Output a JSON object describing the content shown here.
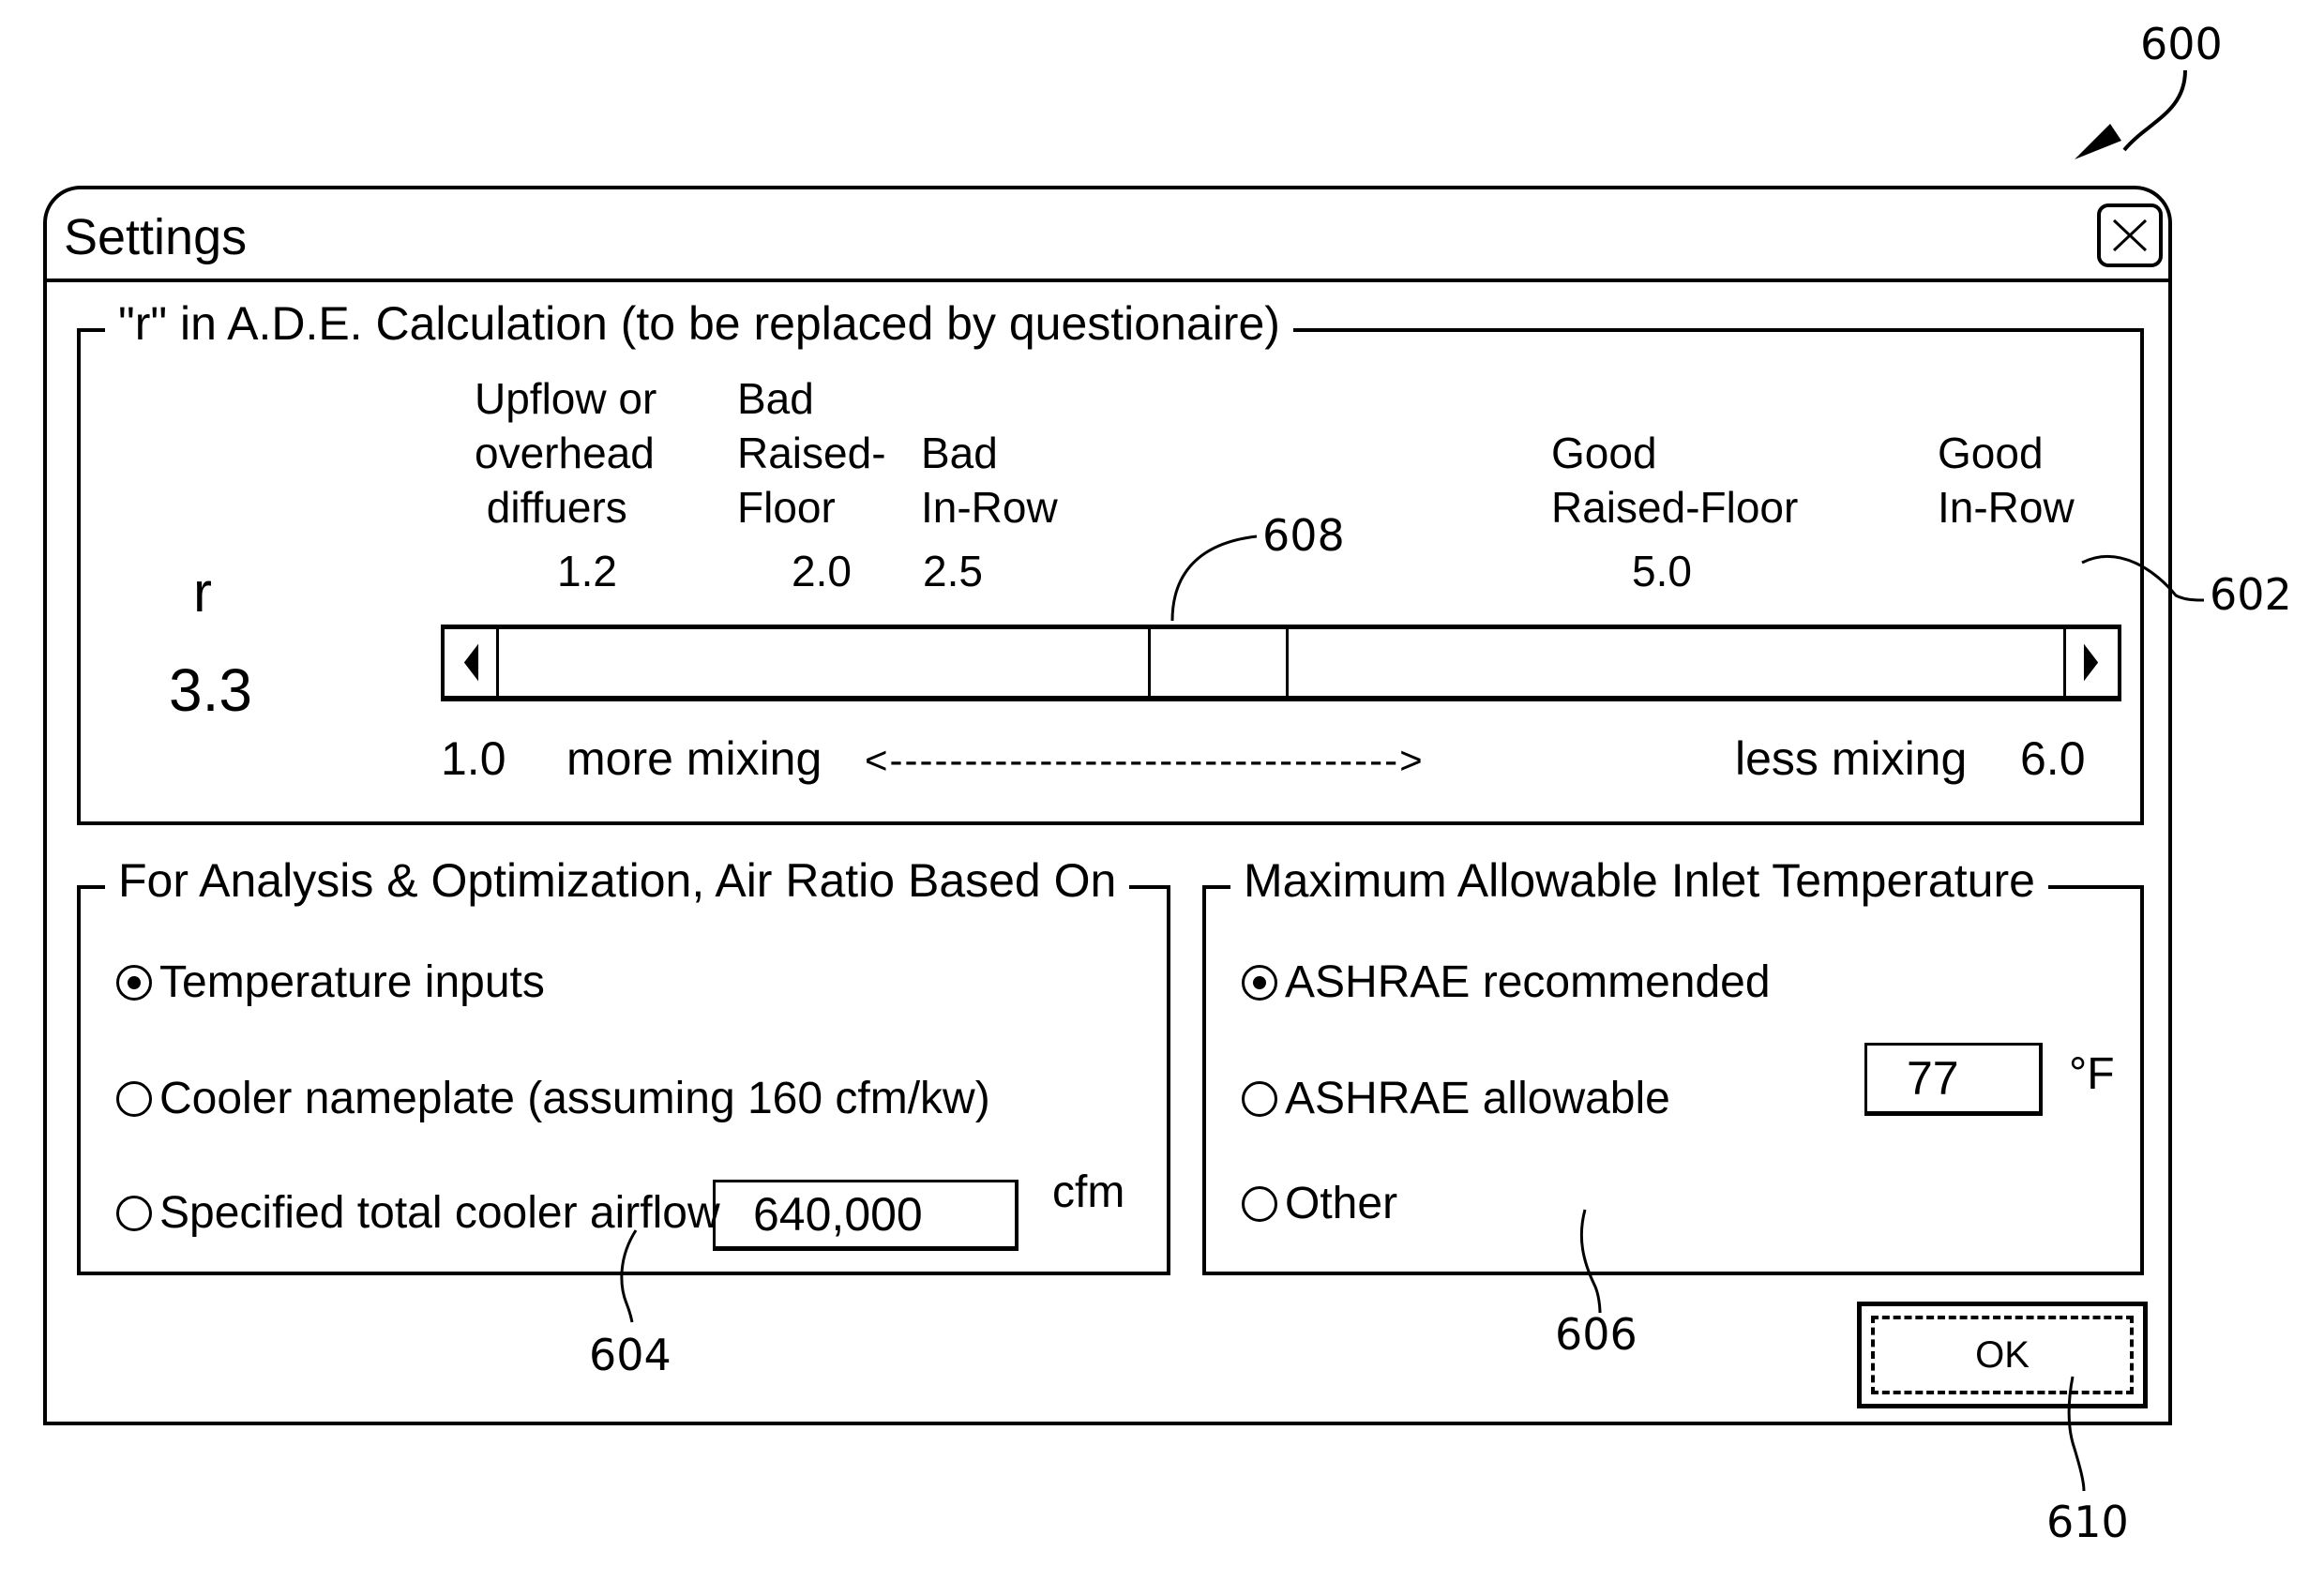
{
  "window": {
    "title": "Settings",
    "close_icon": "close-x-icon"
  },
  "r_group": {
    "legend": "\"r\" in A.D.E. Calculation (to be replaced by questionaire)",
    "r_label": "r",
    "r_value": "3.3",
    "slider": {
      "min": 1.0,
      "max": 6.0,
      "value": 3.3,
      "min_label": "1.0",
      "max_label": "6.0",
      "left_text": "more mixing",
      "right_text": "less mixing",
      "direction_arrow": "<---------------------------------->",
      "left_arrow_icon": "triangle-left-icon",
      "right_arrow_icon": "triangle-right-icon"
    },
    "presets": [
      {
        "label": "Upflow or\noverhead\n diffuers",
        "value": "1.2"
      },
      {
        "label": "Bad\nRaised-\nFloor",
        "value": "2.0"
      },
      {
        "label": "Bad\nIn-Row",
        "value": "2.5"
      },
      {
        "label": "Good\nRaised-Floor",
        "value": "5.0"
      },
      {
        "label": "Good\nIn-Row",
        "value": ""
      }
    ]
  },
  "air_ratio_group": {
    "legend": "For Analysis & Optimization, Air Ratio Based On",
    "options": [
      {
        "label": "Temperature inputs",
        "selected": true
      },
      {
        "label": "Cooler nameplate (assuming 160 cfm/kw)",
        "selected": false
      },
      {
        "label": "Specified total cooler airflow",
        "selected": false
      }
    ],
    "airflow_value": "640,000",
    "airflow_unit": "cfm"
  },
  "inlet_temp_group": {
    "legend": "Maximum Allowable Inlet Temperature",
    "options": [
      {
        "label": "ASHRAE recommended",
        "selected": true
      },
      {
        "label": "ASHRAE allowable",
        "selected": false
      },
      {
        "label": "Other",
        "selected": false
      }
    ],
    "temp_value": "77",
    "temp_unit": "°F"
  },
  "ok_button": {
    "label": "OK"
  },
  "reference_numerals": {
    "dialog": "600",
    "r_group": "602",
    "air_ratio_group": "604",
    "inlet_temp_group": "606",
    "slider_thumb": "608",
    "ok_button": "610"
  }
}
